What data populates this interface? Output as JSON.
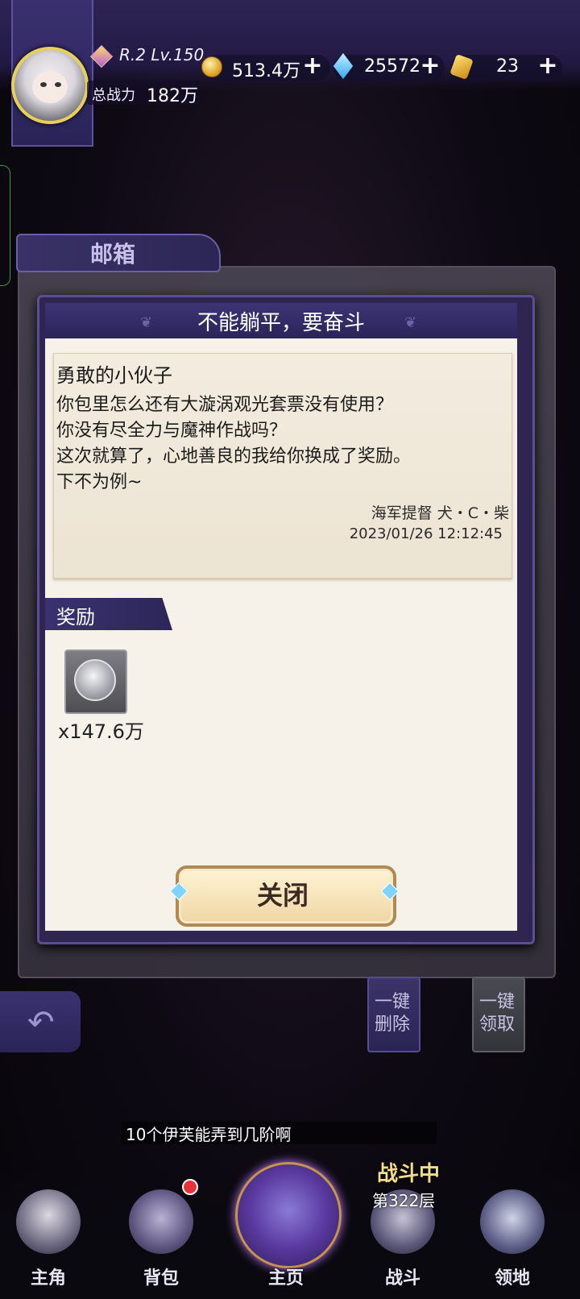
{
  "player": {
    "rank_level": "R.2 Lv.150",
    "power_label": "总战力",
    "power_value": "182万"
  },
  "resources": [
    {
      "icon": "coin-icon",
      "value": "513.4万"
    },
    {
      "icon": "gem-icon",
      "value": "25572"
    },
    {
      "icon": "gold-ticket-icon",
      "value": "23"
    }
  ],
  "mailbox": {
    "title": "邮箱",
    "delete_all": [
      "一键",
      "删除"
    ],
    "claim_all": [
      "一键",
      "领取"
    ]
  },
  "mail": {
    "title": "不能躺平，要奋斗",
    "greeting": "勇敢的小伙子",
    "body": [
      "你包里怎么还有大漩涡观光套票没有使用？",
      "你没有尽全力与魔神作战吗？",
      "这次就算了，心地善良的我给你换成了奖励。",
      "下不为例~"
    ],
    "sender": "海军提督 犬・C・柴",
    "date": "2023/01/26 12:12:45",
    "reward_label": "奖励",
    "reward_item": {
      "icon": "silver-coin-icon",
      "count": "x147.6万"
    },
    "close_label": "关闭"
  },
  "chat": {
    "message": "10个伊芙能弄到几阶啊"
  },
  "nav": {
    "items": [
      "主角",
      "背包",
      "主页",
      "战斗",
      "领地"
    ],
    "battle_status": "战斗中",
    "battle_floor": "第322层"
  },
  "colors": {
    "accent": "#3a3270",
    "paper": "#f6f1e9",
    "badge": "#e8323a"
  }
}
